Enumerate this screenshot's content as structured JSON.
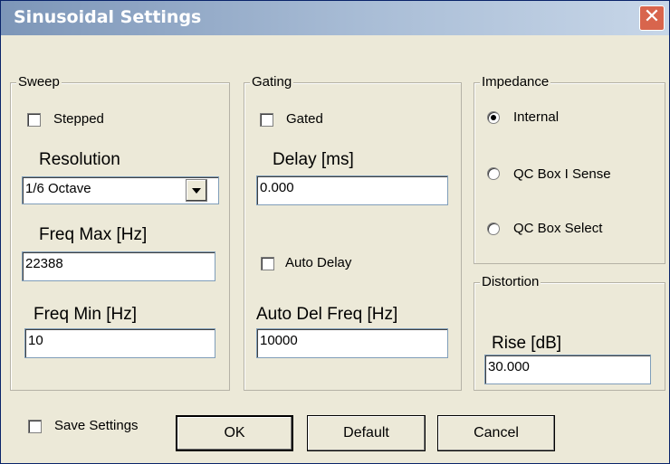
{
  "window": {
    "title": "Sinusoidal Settings",
    "close_glyph": "✕"
  },
  "sweep": {
    "legend": "Sweep",
    "stepped_label": "Stepped",
    "stepped_checked": false,
    "resolution_label": "Resolution",
    "resolution_value": "1/6 Octave",
    "freq_max_label": "Freq Max [Hz]",
    "freq_max_value": "22388",
    "freq_min_label": "Freq Min [Hz]",
    "freq_min_value": "10"
  },
  "gating": {
    "legend": "Gating",
    "gated_label": "Gated",
    "gated_checked": false,
    "delay_label": "Delay [ms]",
    "delay_value": "0.000",
    "auto_delay_label": "Auto Delay",
    "auto_delay_checked": false,
    "auto_del_freq_label": "Auto Del Freq [Hz]",
    "auto_del_freq_value": "10000"
  },
  "impedance": {
    "legend": "Impedance",
    "options": [
      "Internal",
      "QC Box I Sense",
      "QC Box Select"
    ],
    "selected": "Internal"
  },
  "distortion": {
    "legend": "Distortion",
    "rise_label": "Rise [dB]",
    "rise_value": "30.000"
  },
  "footer": {
    "save_settings_label": "Save Settings",
    "save_settings_checked": false,
    "ok_label": "OK",
    "default_label": "Default",
    "cancel_label": "Cancel"
  }
}
